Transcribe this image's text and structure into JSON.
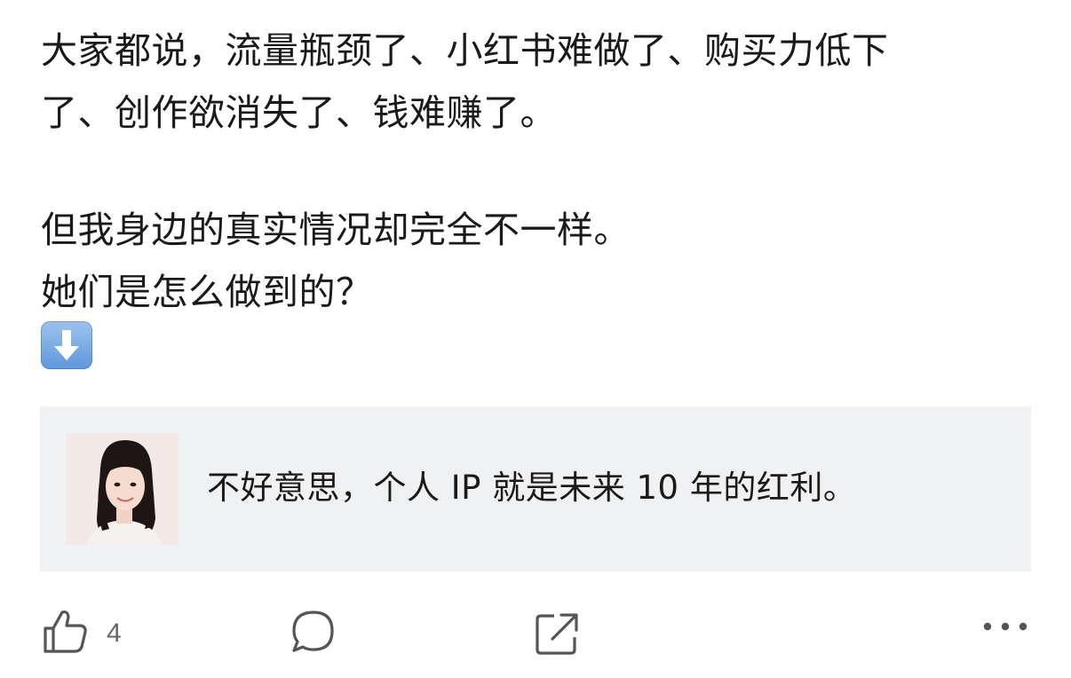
{
  "post": {
    "lines": [
      "大家都说，流量瓶颈了、小红书难做了、购买力低下",
      "了、创作欲消失了、钱难赚了。",
      "",
      "但我身边的真实情况却完全不一样。",
      "她们是怎么做到的？"
    ],
    "emoji": "down-arrow-emoji"
  },
  "quote_card": {
    "text": "不好意思，个人 IP 就是未来 10 年的红利。",
    "avatar": "avatar-image"
  },
  "actions": {
    "like_icon": "thumbs-up-icon",
    "like_count": "4",
    "comment_icon": "comment-bubble-icon",
    "share_icon": "share-icon",
    "more_icon": "more-dots-icon"
  },
  "colors": {
    "text": "#1a1a1a",
    "card_bg": "#f0f1f3",
    "icon": "#555555",
    "emoji_blue": "#6fa3e0"
  }
}
